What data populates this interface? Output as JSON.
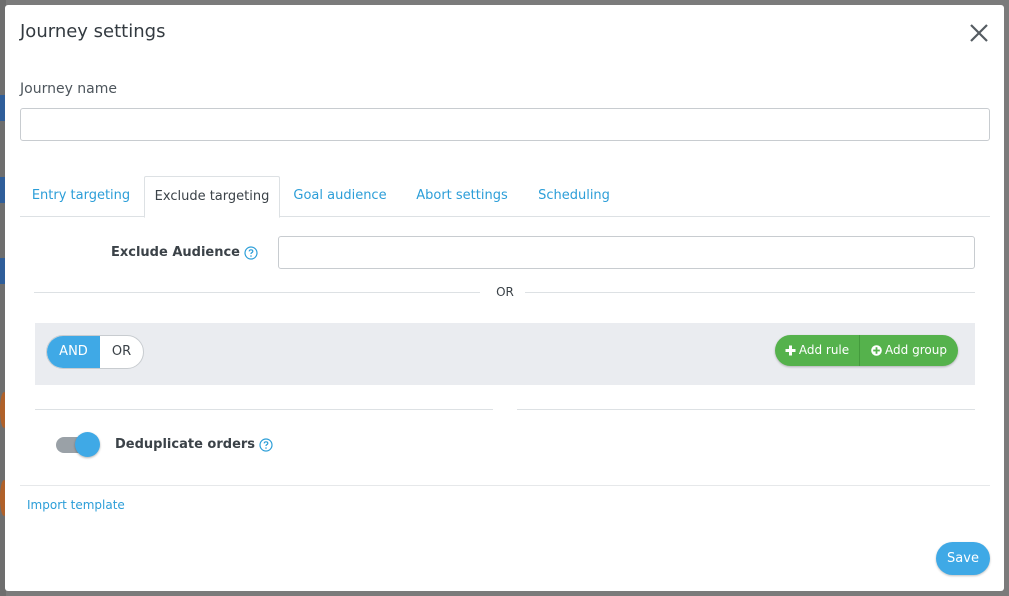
{
  "modal": {
    "title": "Journey settings"
  },
  "journey_name": {
    "label": "Journey name",
    "value": "",
    "placeholder": ""
  },
  "tabs": [
    {
      "label": "Entry targeting",
      "active": false
    },
    {
      "label": "Exclude targeting",
      "active": true
    },
    {
      "label": "Goal audience",
      "active": false
    },
    {
      "label": "Abort settings",
      "active": false
    },
    {
      "label": "Scheduling",
      "active": false
    }
  ],
  "exclude": {
    "audience_label": "Exclude Audience",
    "audience_value": "",
    "or_divider": "OR"
  },
  "rules": {
    "and_label": "AND",
    "or_label": "OR",
    "selected": "AND",
    "add_rule_label": "Add rule",
    "add_group_label": "Add group"
  },
  "dedup": {
    "label": "Deduplicate orders",
    "enabled": true
  },
  "footer": {
    "import_label": "Import template",
    "save_label": "Save"
  },
  "colors": {
    "accent": "#3fa9e6",
    "link": "#2c9ed8",
    "success": "#55b24c"
  },
  "icons": {
    "close": "close-icon",
    "help": "question-circle-icon",
    "add_rule": "plus-icon",
    "add_group": "plus-circle-icon"
  }
}
